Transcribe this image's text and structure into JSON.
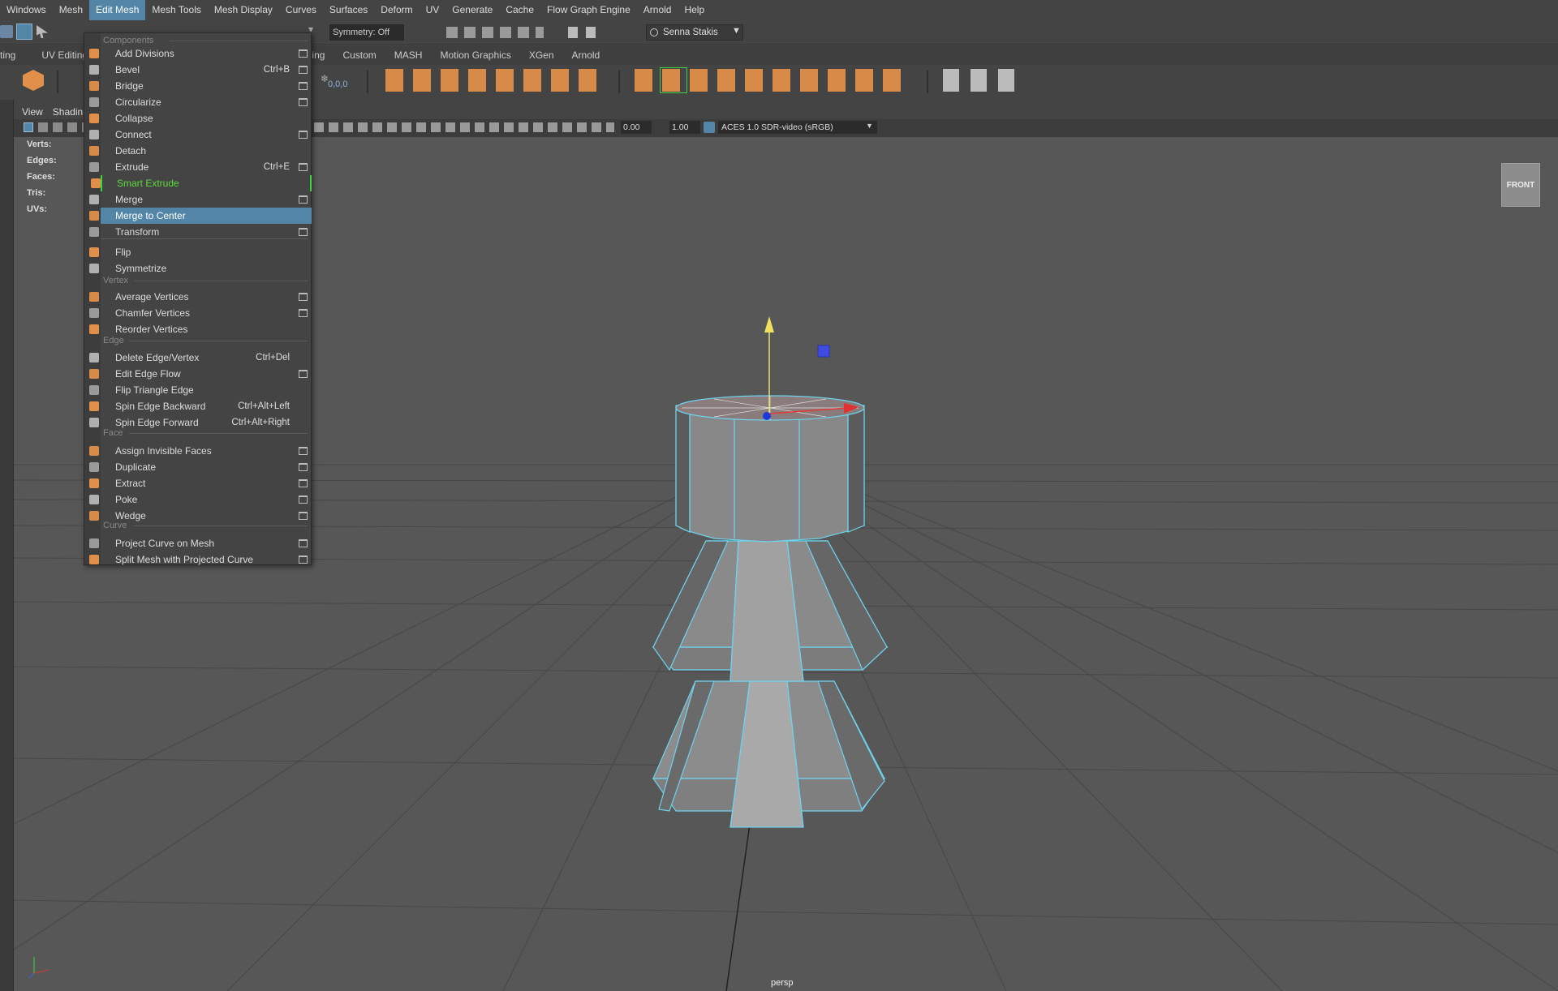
{
  "menubar": {
    "items": [
      "Windows",
      "Mesh",
      "Edit Mesh",
      "Mesh Tools",
      "Mesh Display",
      "Curves",
      "Surfaces",
      "Deform",
      "UV",
      "Generate",
      "Cache",
      "Flow Graph Engine",
      "Arnold",
      "Help"
    ],
    "active": "Edit Mesh"
  },
  "statusline": {
    "symmetry": "Symmetry: Off",
    "user": "Senna Stakis"
  },
  "shelf": {
    "tabs": [
      "ting",
      "UV Editing",
      "X Caching",
      "Custom",
      "MASH",
      "Motion Graphics",
      "XGen",
      "Arnold"
    ],
    "coords": "0,0,0"
  },
  "panel": {
    "menus": [
      "View",
      "Shadin"
    ],
    "exposure": "0.00",
    "gamma": "1.00",
    "colorspace": "ACES 1.0 SDR-video (sRGB)"
  },
  "hud": {
    "verts": "Verts:",
    "edges": "Edges:",
    "faces": "Faces:",
    "tris": "Tris:",
    "uvs": "UVs:"
  },
  "menu": {
    "components_header": "Components",
    "vertex_header": "Vertex",
    "edge_header": "Edge",
    "face_header": "Face",
    "curve_header": "Curve",
    "items": [
      {
        "label": "Add Divisions",
        "shortcut": "",
        "option": true
      },
      {
        "label": "Bevel",
        "shortcut": "Ctrl+B",
        "option": true
      },
      {
        "label": "Bridge",
        "shortcut": "",
        "option": true
      },
      {
        "label": "Circularize",
        "shortcut": "",
        "option": true
      },
      {
        "label": "Collapse",
        "shortcut": "",
        "option": false
      },
      {
        "label": "Connect",
        "shortcut": "",
        "option": true
      },
      {
        "label": "Detach",
        "shortcut": "",
        "option": false
      },
      {
        "label": "Extrude",
        "shortcut": "Ctrl+E",
        "option": true
      },
      {
        "label": "Smart Extrude",
        "shortcut": "",
        "option": false
      },
      {
        "label": "Merge",
        "shortcut": "",
        "option": true
      },
      {
        "label": "Merge to Center",
        "shortcut": "",
        "option": false
      },
      {
        "label": "Transform",
        "shortcut": "",
        "option": true
      },
      {
        "label": "Flip",
        "shortcut": "",
        "option": false
      },
      {
        "label": "Symmetrize",
        "shortcut": "",
        "option": false
      },
      {
        "label": "Average Vertices",
        "shortcut": "",
        "option": true
      },
      {
        "label": "Chamfer Vertices",
        "shortcut": "",
        "option": true
      },
      {
        "label": "Reorder Vertices",
        "shortcut": "",
        "option": false
      },
      {
        "label": "Delete Edge/Vertex",
        "shortcut": "Ctrl+Del",
        "option": false
      },
      {
        "label": "Edit Edge Flow",
        "shortcut": "",
        "option": true
      },
      {
        "label": "Flip Triangle Edge",
        "shortcut": "",
        "option": false
      },
      {
        "label": "Spin Edge Backward",
        "shortcut": "Ctrl+Alt+Left",
        "option": false
      },
      {
        "label": "Spin Edge Forward",
        "shortcut": "Ctrl+Alt+Right",
        "option": false
      },
      {
        "label": "Assign Invisible Faces",
        "shortcut": "",
        "option": true
      },
      {
        "label": "Duplicate",
        "shortcut": "",
        "option": true
      },
      {
        "label": "Extract",
        "shortcut": "",
        "option": true
      },
      {
        "label": "Poke",
        "shortcut": "",
        "option": true
      },
      {
        "label": "Wedge",
        "shortcut": "",
        "option": true
      },
      {
        "label": "Project Curve on Mesh",
        "shortcut": "",
        "option": true
      },
      {
        "label": "Split Mesh with Projected Curve",
        "shortcut": "",
        "option": true
      }
    ],
    "highlighted": "Merge to Center",
    "accent": "#5285a6",
    "smart_extrude_color": "#5cdc3c"
  },
  "viewport": {
    "viewcube": "FRONT",
    "camera": "persp"
  }
}
